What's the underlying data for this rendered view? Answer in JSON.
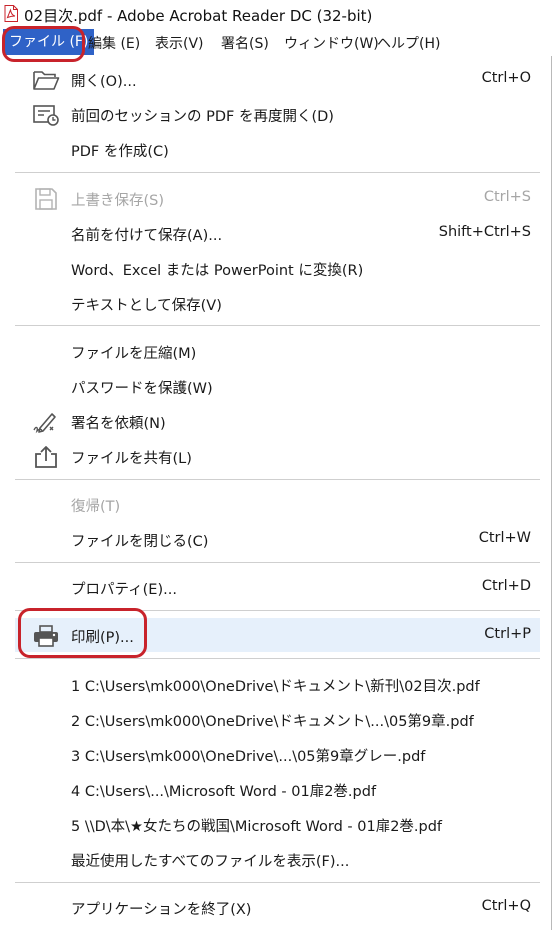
{
  "window": {
    "title": "02目次.pdf - Adobe Acrobat Reader DC (32-bit)"
  },
  "menubar": {
    "items": [
      {
        "label": "ファイル (F)"
      },
      {
        "label": "編集 (E)"
      },
      {
        "label": "表示(V)"
      },
      {
        "label": "署名(S)"
      },
      {
        "label": "ウィンドウ(W)"
      },
      {
        "label": "ヘルプ(H)"
      }
    ]
  },
  "menu": {
    "items": [
      {
        "label": "開く(O)...",
        "shortcut": "Ctrl+O",
        "icon": "folder-open-icon"
      },
      {
        "label": "前回のセッションの PDF を再度開く(D)",
        "shortcut": "",
        "icon": "restore-session-icon"
      },
      {
        "label": "PDF を作成(C)",
        "shortcut": ""
      },
      {
        "label": "上書き保存(S)",
        "shortcut": "Ctrl+S",
        "icon": "save-icon",
        "disabled": true
      },
      {
        "label": "名前を付けて保存(A)...",
        "shortcut": "Shift+Ctrl+S"
      },
      {
        "label": "Word、Excel または PowerPoint に変換(R)",
        "shortcut": ""
      },
      {
        "label": "テキストとして保存(V)",
        "shortcut": ""
      },
      {
        "label": "ファイルを圧縮(M)",
        "shortcut": ""
      },
      {
        "label": "パスワードを保護(W)",
        "shortcut": ""
      },
      {
        "label": "署名を依頼(N)",
        "shortcut": "",
        "icon": "sign-pen-icon"
      },
      {
        "label": "ファイルを共有(L)",
        "shortcut": "",
        "icon": "share-icon"
      },
      {
        "label": "復帰(T)",
        "shortcut": "",
        "disabled": true
      },
      {
        "label": "ファイルを閉じる(C)",
        "shortcut": "Ctrl+W"
      },
      {
        "label": "プロパティ(E)...",
        "shortcut": "Ctrl+D"
      },
      {
        "label": "印刷(P)...",
        "shortcut": "Ctrl+P",
        "icon": "printer-icon",
        "highlighted": true
      },
      {
        "label": "1 C:\\Users\\mk000\\OneDrive\\ドキュメント\\新刊\\02目次.pdf",
        "shortcut": ""
      },
      {
        "label": "2 C:\\Users\\mk000\\OneDrive\\ドキュメント\\...\\05第9章.pdf",
        "shortcut": ""
      },
      {
        "label": "3 C:\\Users\\mk000\\OneDrive\\...\\05第9章グレー.pdf",
        "shortcut": ""
      },
      {
        "label": "4 C:\\Users\\...\\Microsoft Word - 01扉2巻.pdf",
        "shortcut": ""
      },
      {
        "label": "5 \\\\D\\本\\★女たちの戦国\\Microsoft Word - 01扉2巻.pdf",
        "shortcut": ""
      },
      {
        "label": "最近使用したすべてのファイルを表示(F)...",
        "shortcut": ""
      },
      {
        "label": "アプリケーションを終了(X)",
        "shortcut": "Ctrl+Q"
      }
    ]
  },
  "colors": {
    "accent": "#2f62c7",
    "annotation": "#c8232b",
    "hover": "#e6f0fb",
    "disabled": "#a6a6a6"
  }
}
